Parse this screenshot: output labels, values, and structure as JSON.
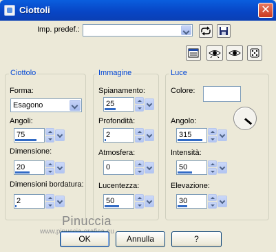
{
  "window": {
    "title": "Ciottoli"
  },
  "preset": {
    "label": "Imp. predef.:",
    "value": ""
  },
  "groups": {
    "ciottolo": {
      "title": "Ciottolo",
      "forma_label": "Forma:",
      "forma_value": "Esagono",
      "angoli_label": "Angoli:",
      "angoli_value": "75",
      "angoli_level": 0.75,
      "dimensione_label": "Dimensione:",
      "dimensione_value": "20",
      "dimensione_level": 0.5,
      "bordatura_label": "Dimensioni bordatura:",
      "bordatura_value": "2",
      "bordatura_level": 0.05
    },
    "immagine": {
      "title": "Immagine",
      "spianamento_label": "Spianamento:",
      "spianamento_value": "25",
      "spianamento_level": 0.4,
      "profondita_label": "Profondità:",
      "profondita_value": "2",
      "profondita_level": 0.05,
      "atmosfera_label": "Atmosfera:",
      "atmosfera_value": "0",
      "atmosfera_level": 0.0,
      "lucentezza_label": "Lucentezza:",
      "lucentezza_value": "50",
      "lucentezza_level": 0.5
    },
    "luce": {
      "title": "Luce",
      "colore_label": "Colore:",
      "colore_value": "#ffffff",
      "angolo_label": "Angolo:",
      "angolo_value": "315",
      "angolo_level": 0.875,
      "intensita_label": "Intensità:",
      "intensita_value": "50",
      "intensita_level": 0.5,
      "elevazione_label": "Elevazione:",
      "elevazione_value": "30",
      "elevazione_level": 0.33
    }
  },
  "buttons": {
    "ok": "OK",
    "annulla": "Annulla",
    "help": "?"
  },
  "watermark": {
    "line1": "Pinuccia",
    "line2": "www.pinuccia-grafica.eu"
  },
  "icons": {
    "save_preset": "floppy-disk-icon",
    "load_preset": "refresh-arrow-icon",
    "reset": "reset-dialog-icon",
    "proof": "eye-icon",
    "random": "dice-icon"
  },
  "colors": {
    "accent": "#0046d5",
    "title_bar": "#0a5ede",
    "close": "#c9381e",
    "level_bar": "#316ac5"
  }
}
